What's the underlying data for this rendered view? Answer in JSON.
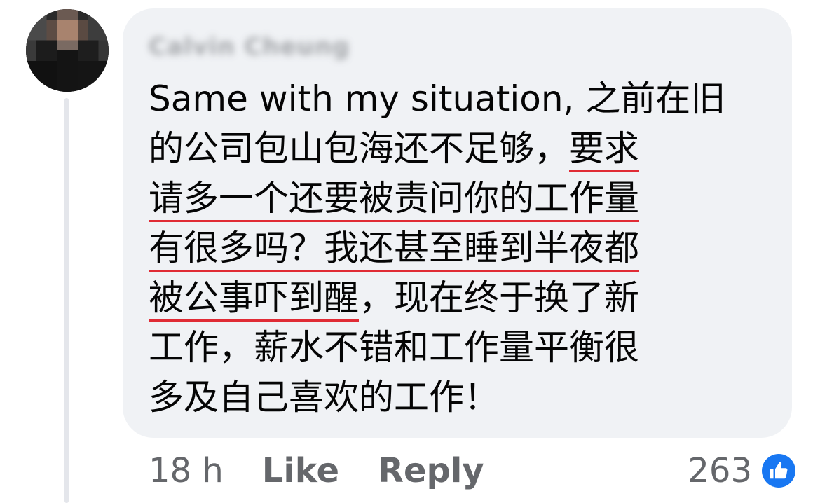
{
  "comment": {
    "author_name": "Calvin Cheung",
    "lines": [
      [
        {
          "t": "Same with my situation, 之前在旧",
          "hl": false
        }
      ],
      [
        {
          "t": "的公司包山包海还不足够，",
          "hl": false
        },
        {
          "t": "要求",
          "hl": true
        }
      ],
      [
        {
          "t": "请多一个还要被责问你的工作量",
          "hl": true
        }
      ],
      [
        {
          "t": "有很多吗？我还甚至睡到半夜都",
          "hl": true
        }
      ],
      [
        {
          "t": "被公事吓到醒",
          "hl": true
        },
        {
          "t": "，现在终于换了新",
          "hl": false
        }
      ],
      [
        {
          "t": "工作，薪水不错和工作量平衡很",
          "hl": false
        }
      ],
      [
        {
          "t": "多及自己喜欢的工作！",
          "hl": false
        }
      ]
    ]
  },
  "actions": {
    "timestamp": "18 h",
    "like_label": "Like",
    "reply_label": "Reply"
  },
  "reactions": {
    "count": "263",
    "icon": "thumbs-up-icon"
  },
  "colors": {
    "bubble": "#f0f2f5",
    "underline": "#e02b35",
    "like_blue": "#1877f2",
    "meta_text": "#65676b"
  }
}
